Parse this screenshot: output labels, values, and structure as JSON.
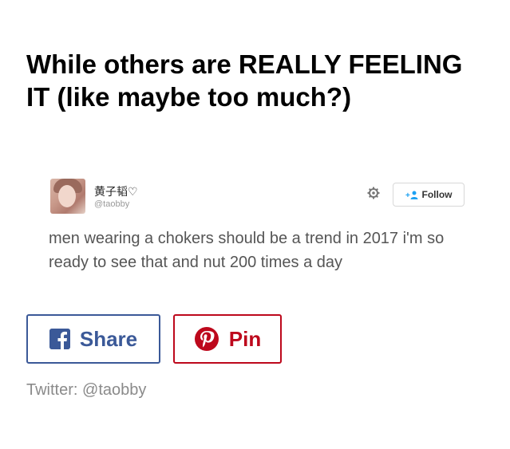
{
  "headline": "While others are REALLY FEELING IT (like maybe too much?)",
  "tweet": {
    "display_name": "黄子韬♡",
    "handle": "@taobby",
    "follow_label": "Follow",
    "text": "men wearing a chokers should be a trend in 2017 i'm so ready to see that and nut 200 times a day",
    "icons": {
      "settings": "gear-icon",
      "follow": "person-plus-icon"
    }
  },
  "share": {
    "facebook_label": "Share",
    "pinterest_label": "Pin",
    "colors": {
      "facebook": "#3b5998",
      "pinterest": "#bd081c"
    },
    "icons": {
      "facebook": "facebook-icon",
      "pinterest": "pinterest-icon"
    }
  },
  "source": "Twitter: @taobby"
}
